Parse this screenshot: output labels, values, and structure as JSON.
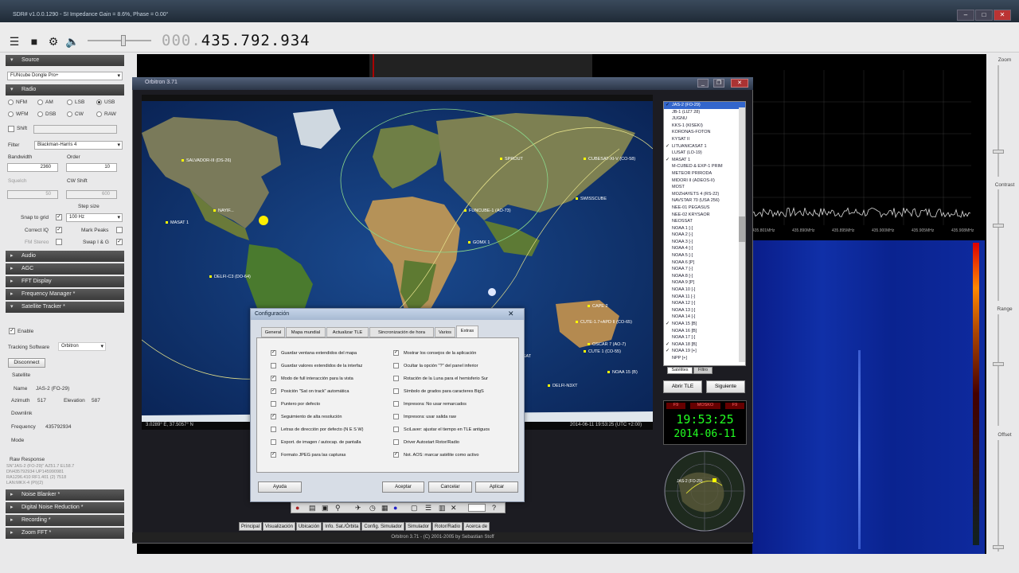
{
  "window": {
    "title": "SDR# v1.0.0.1290 - SI Impedance Gain = 8.6%, Phase = 0.00°"
  },
  "toolbar": {
    "freq_dim": "000.",
    "freq_main": "435.792.934"
  },
  "left": {
    "sections": {
      "source": "Source",
      "radio": "Radio",
      "audio": "Audio",
      "agc": "AGC",
      "fft": "FFT Display",
      "freqmgr": "Frequency Manager *",
      "sattrack": "Satellite Tracker *",
      "noise": "Noise Blanker *",
      "dnr": "Digital Noise Reduction *",
      "recording": "Recording *",
      "zoomfft": "Zoom FFT *"
    },
    "source_device": "FUNcube Dongle Pro+",
    "modes": [
      "NFM",
      "AM",
      "LSB",
      "USB",
      "WFM",
      "DSB",
      "CW",
      "RAW"
    ],
    "shift_label": "Shift",
    "filter_label": "Filter",
    "filter_value": "Blackman-Harris 4",
    "bandwidth_label": "Bandwidth",
    "bandwidth_value": "2360",
    "order_label": "Order",
    "order_value": "10",
    "squelch_label": "Squelch",
    "cwshift_label": "CW Shift",
    "squelch_value": "50",
    "cwshift_value": "600",
    "stepsize_label": "Step size",
    "snap_label": "Snap to grid",
    "snap_value": "100 Hz",
    "correctiq_label": "Correct IQ",
    "markpeaks_label": "Mark Peaks",
    "fmstereo_label": "FM Stereo",
    "swapiq_label": "Swap I & G",
    "enable_label": "Enable",
    "tracking_label": "Tracking Software",
    "tracking_value": "Orbitron",
    "disconnect_label": "Disconnect",
    "satellite_label": "Satellite",
    "name_label": "Name",
    "name_value": "JAS-2 (FO-29)",
    "azimuth_label": "Azimuth",
    "azimuth_value": "517",
    "elevation_label": "Elevation",
    "elevation_value": "587",
    "downlink_label": "Downlink",
    "frequency_label": "Frequency",
    "frequency_value": "435792934",
    "mode_label": "Mode",
    "raw_label": "Raw Response",
    "raw_lines": [
      "SN\"JAS-2 (FO-29)\" AZ51.7 EL58.7",
      "DN435792934 UP145990981",
      "RA1296.410 RF1.401 (2) 7518",
      "LAN:MKX-4 (PI)(2)"
    ]
  },
  "right": {
    "zoom": "Zoom",
    "contrast": "Contrast",
    "range": "Range",
    "offset": "Offset"
  },
  "spectrum": {
    "ticks": [
      "435.801MHz",
      "435.890MHz",
      "435.895MHz",
      "435.900MHz",
      "435.905MHz",
      "435.908MHz"
    ]
  },
  "orbitron": {
    "title": "Orbitron 3.71",
    "status_left": "3.0289° E, 37.5057° N",
    "status_right": "2014-06-11 19:53:25 (UTC +2:00)",
    "footer": "Orbitron 3.71 - (C) 2001-2005 by Sebastian Stoff",
    "sat_labels": [
      "SALVADOR-III (DS-26)",
      "DELFI-C3 (DO-64)",
      "MASAT 1",
      "NAYIF...",
      "SPROUT",
      "CUBESAT-XI-V (CO-58)",
      "SWISSCUBE",
      "FUNCUBE-1 (AO-73)",
      "GOMX 1",
      "CUTE-1.7+APD II (CO-65)",
      "DELFI-N3XT",
      "CAPE 2",
      "TSHEPISOSAT",
      "OSCAR 7 (AO-7)",
      "CUTE 1 (CO-55)",
      "NOAA 15 (B)"
    ],
    "satlist": [
      {
        "n": "JAS-2 (FO-29)",
        "c": true,
        "s": true
      },
      {
        "n": "JB-1 (LIZ7 28)",
        "c": false
      },
      {
        "n": "JUGNU",
        "c": false
      },
      {
        "n": "KKS-1 (KISEKI)",
        "c": false
      },
      {
        "n": "KORONAS-FOTON",
        "c": false
      },
      {
        "n": "KYSAT II",
        "c": false
      },
      {
        "n": "LITUANICASAT 1",
        "c": true
      },
      {
        "n": "LUSAT (LO-19)",
        "c": false
      },
      {
        "n": "MASAT 1",
        "c": true
      },
      {
        "n": "M-CUBED & EXP-1 PRIM",
        "c": false
      },
      {
        "n": "METEOR PRIRODA",
        "c": false
      },
      {
        "n": "MIDORI II (ADEOS-II)",
        "c": false
      },
      {
        "n": "MOST",
        "c": false
      },
      {
        "n": "MOZHAYETS 4 (RS-22)",
        "c": false
      },
      {
        "n": "NAVSTAR 70 (USA 256)",
        "c": false
      },
      {
        "n": "NEE-01 PEGASUS",
        "c": false
      },
      {
        "n": "NEE-02 KRYSAOR",
        "c": false
      },
      {
        "n": "NEOSSAT",
        "c": false
      },
      {
        "n": "NOAA 1 [-]",
        "c": false
      },
      {
        "n": "NOAA 2 [-]",
        "c": false
      },
      {
        "n": "NOAA 3 [-]",
        "c": false
      },
      {
        "n": "NOAA 4 [-]",
        "c": false
      },
      {
        "n": "NOAA 5 [-]",
        "c": false
      },
      {
        "n": "NOAA 6 [P]",
        "c": false
      },
      {
        "n": "NOAA 7 [-]",
        "c": false
      },
      {
        "n": "NOAA 8 [-]",
        "c": false
      },
      {
        "n": "NOAA 9 [P]",
        "c": false
      },
      {
        "n": "NOAA 10 [-]",
        "c": false
      },
      {
        "n": "NOAA 11 [-]",
        "c": false
      },
      {
        "n": "NOAA 12 [-]",
        "c": false
      },
      {
        "n": "NOAA 13 [-]",
        "c": false
      },
      {
        "n": "NOAA 14 [-]",
        "c": false
      },
      {
        "n": "NOAA 15 [B]",
        "c": true
      },
      {
        "n": "NOAA 16 [B]",
        "c": false
      },
      {
        "n": "NOAA 17 [-]",
        "c": false
      },
      {
        "n": "NOAA 18 [B]",
        "c": true
      },
      {
        "n": "NOAA 19 [+]",
        "c": true
      },
      {
        "n": "NPP [+]",
        "c": false
      }
    ],
    "list_tab1": "Satélites",
    "list_tab2": "Filtro",
    "open_tle": "Abrir TLE",
    "next": "Siguiente",
    "clock_top": [
      "F9",
      "MOSKO",
      "F9"
    ],
    "clock_time": "19:53:25",
    "clock_date": "2014-06-11",
    "radar_label": "JAS-2 (FO-29)",
    "bottom_tabs": [
      "Principal",
      "Visualización",
      "Ubicación",
      "Info. Sat./Órbita",
      "Config. Simulador",
      "Simulador",
      "Rotor/Radio",
      "Acerca de"
    ]
  },
  "config": {
    "title": "Configuración",
    "tabs": [
      "General",
      "Mapa mundial",
      "Actualizar TLE",
      "Sincronización de hora",
      "Varios",
      "Extras"
    ],
    "left_opts": [
      {
        "t": "Guardar ventana extendidos del mapa",
        "c": true
      },
      {
        "t": "Guardar valores extendidos de la interfaz",
        "c": false
      },
      {
        "t": "Modo de full interacción para la vista",
        "c": true
      },
      {
        "t": "Posición \"Sat on track\" automática",
        "c": true
      },
      {
        "t": "Puntero por defecto",
        "c": false
      },
      {
        "t": "Seguimiento de alta resolución",
        "c": true
      },
      {
        "t": "Letras de dirección por defecto (N E S W)",
        "c": false
      },
      {
        "t": "Export. de imagen / autocap. de pantalla",
        "c": false
      },
      {
        "t": "Formato JPEG para las capturas",
        "c": true
      }
    ],
    "right_opts": [
      {
        "t": "Mostrar los consejos de la aplicación",
        "c": true
      },
      {
        "t": "Ocultar la opción \"?\" del panel inferior",
        "c": false
      },
      {
        "t": "Rotación de la Luna para el hemisferio Sur",
        "c": false
      },
      {
        "t": "Símbolo de grados para caracteres BigS",
        "c": false
      },
      {
        "t": "Impresora: No usar remarcados",
        "c": false
      },
      {
        "t": "Impresora: usar salida raw",
        "c": false
      },
      {
        "t": "SciLaver: ajustar el tiempo en TLE antiguos",
        "c": false
      },
      {
        "t": "Driver Autostart Rotor/Radio",
        "c": false
      },
      {
        "t": "Not. AOS: marcar satélite como activo",
        "c": true
      }
    ],
    "help": "Ayuda",
    "ok": "Aceptar",
    "cancel": "Cancelar",
    "apply": "Aplicar"
  }
}
